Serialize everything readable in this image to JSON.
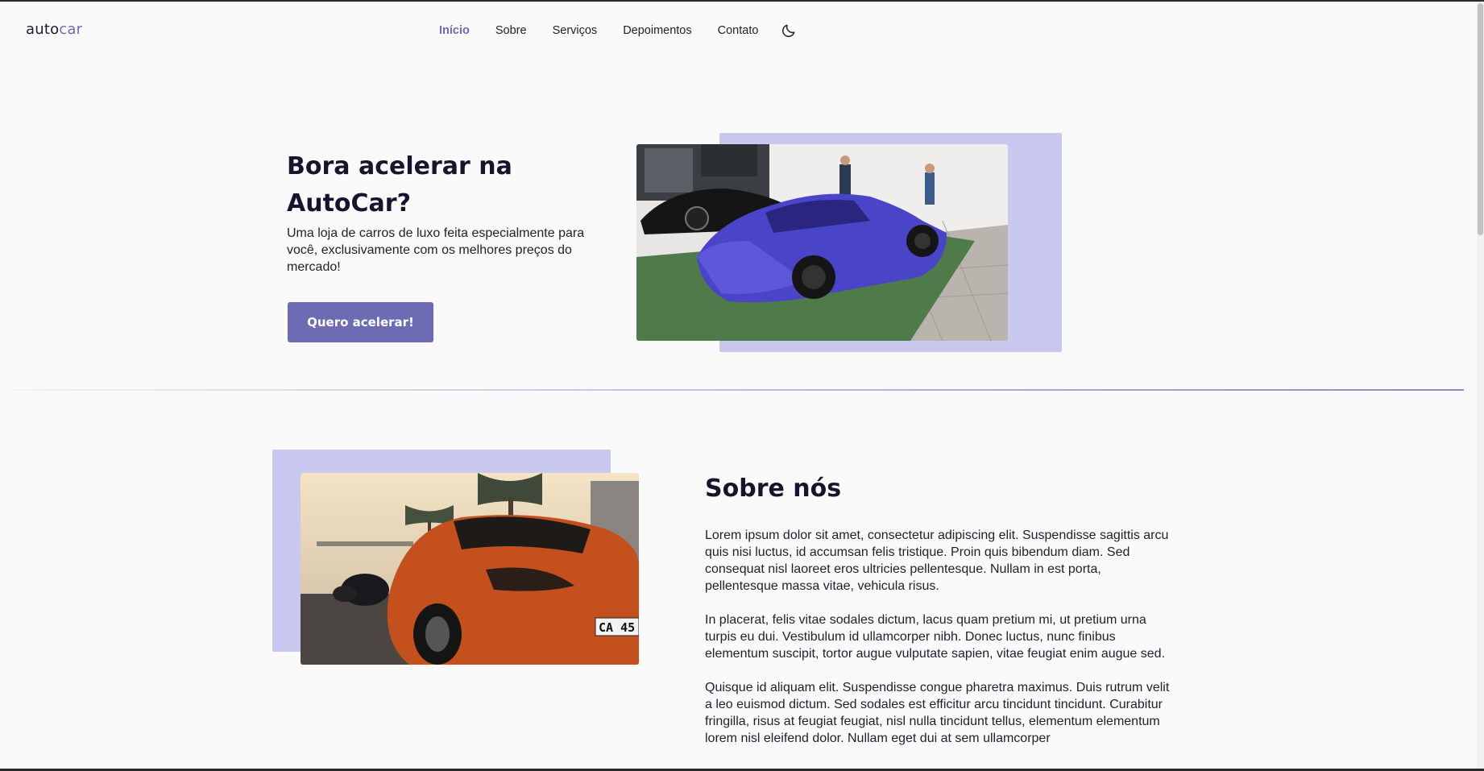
{
  "header": {
    "logo_prefix": "auto",
    "logo_suffix": "car",
    "nav": [
      "Início",
      "Sobre",
      "Serviços",
      "Depoimentos",
      "Contato"
    ],
    "active_nav": "Início",
    "theme_icon": "moon-icon"
  },
  "hero": {
    "title": "Bora acelerar na AutoCar?",
    "description": "Uma loja de carros de luxo feita especialmente para você, exclusivamente com os melhores preços do mercado!",
    "button_label": "Quero acelerar!",
    "image": "blue-sports-car-photo"
  },
  "about": {
    "title": "Sobre nós",
    "paragraphs": [
      "Lorem ipsum dolor sit amet, consectetur adipiscing elit. Suspendisse sagittis arcu quis nisi luctus, id accumsan felis tristique. Proin quis bibendum diam. Sed consequat nisl laoreet eros ultricies pellentesque. Nullam in est porta, pellentesque massa vitae, vehicula risus.",
      "In placerat, felis vitae sodales dictum, lacus quam pretium mi, ut pretium urna turpis eu dui. Vestibulum id ullamcorper nibh. Donec luctus, nunc finibus elementum suscipit, tortor augue vulputate sapien, vitae feugiat enim augue sed.",
      "Quisque id aliquam elit. Suspendisse congue pharetra maximus. Duis rutrum velit a leo euismod dictum. Sed sodales est efficitur arcu tincidunt tincidunt. Curabitur fringilla, risus at feugiat feugiat, nisl nulla tincidunt tellus, elementum elementum lorem nisl eleifend dolor. Nullam eget dui at sem ullamcorper"
    ],
    "image": "orange-sports-car-photo",
    "plate_text": "CA 45"
  },
  "colors": {
    "accent": "#6c6bb4",
    "backdrop": "#c9c8ee",
    "background": "#fafafa",
    "text": "#15152b"
  }
}
